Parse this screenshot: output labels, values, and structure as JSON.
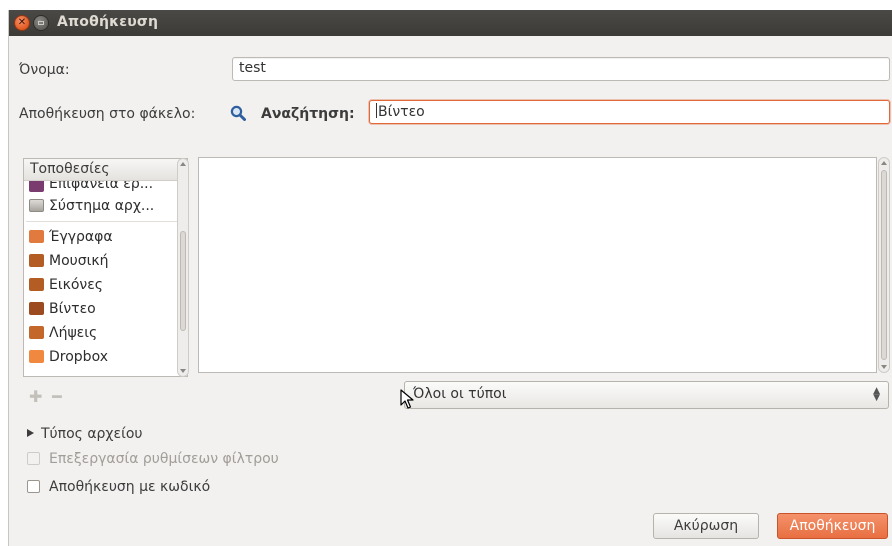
{
  "window": {
    "title": "Αποθήκευση"
  },
  "name_row": {
    "label": "Όνομα:",
    "value": "test"
  },
  "folder_row": {
    "label": "Αποθήκευση στο φάκελο:",
    "search_label": "Αναζήτηση:",
    "search_value": "Βίντεο"
  },
  "places": {
    "header": "Τοποθεσίες",
    "items": [
      {
        "label": "Επιφάνεια ερ...",
        "icon": "desktop-icon",
        "color": "#7a3c6e"
      },
      {
        "label": "Σύστημα αρχ...",
        "icon": "filesystem-icon",
        "color": "#b9b6b1"
      },
      {
        "label": "Έγγραφα",
        "icon": "documents-folder-icon",
        "color": "#e07a3e"
      },
      {
        "label": "Μουσική",
        "icon": "music-folder-icon",
        "color": "#b35d24"
      },
      {
        "label": "Εικόνες",
        "icon": "pictures-folder-icon",
        "color": "#b35d24"
      },
      {
        "label": "Βίντεο",
        "icon": "videos-folder-icon",
        "color": "#9c4a1f"
      },
      {
        "label": "Λήψεις",
        "icon": "downloads-folder-icon",
        "color": "#c3672b"
      },
      {
        "label": "Dropbox",
        "icon": "dropbox-folder-icon",
        "color": "#f0883f"
      }
    ]
  },
  "filter": {
    "selected": "Όλοι οι τύποι"
  },
  "expander": {
    "label": "Τύπος αρχείου"
  },
  "options": {
    "edit_filter": {
      "label": "Επεξεργασία ρυθμίσεων φίλτρου",
      "checked": false,
      "enabled": false
    },
    "password": {
      "label": "Αποθήκευση με κωδικό",
      "checked": false,
      "enabled": true
    }
  },
  "buttons": {
    "cancel": "Ακύρωση",
    "save": "Αποθήκευση"
  },
  "colors": {
    "accent": "#e86f42",
    "titlebar": "#3c3b37",
    "window_bg": "#f2f1f0"
  }
}
